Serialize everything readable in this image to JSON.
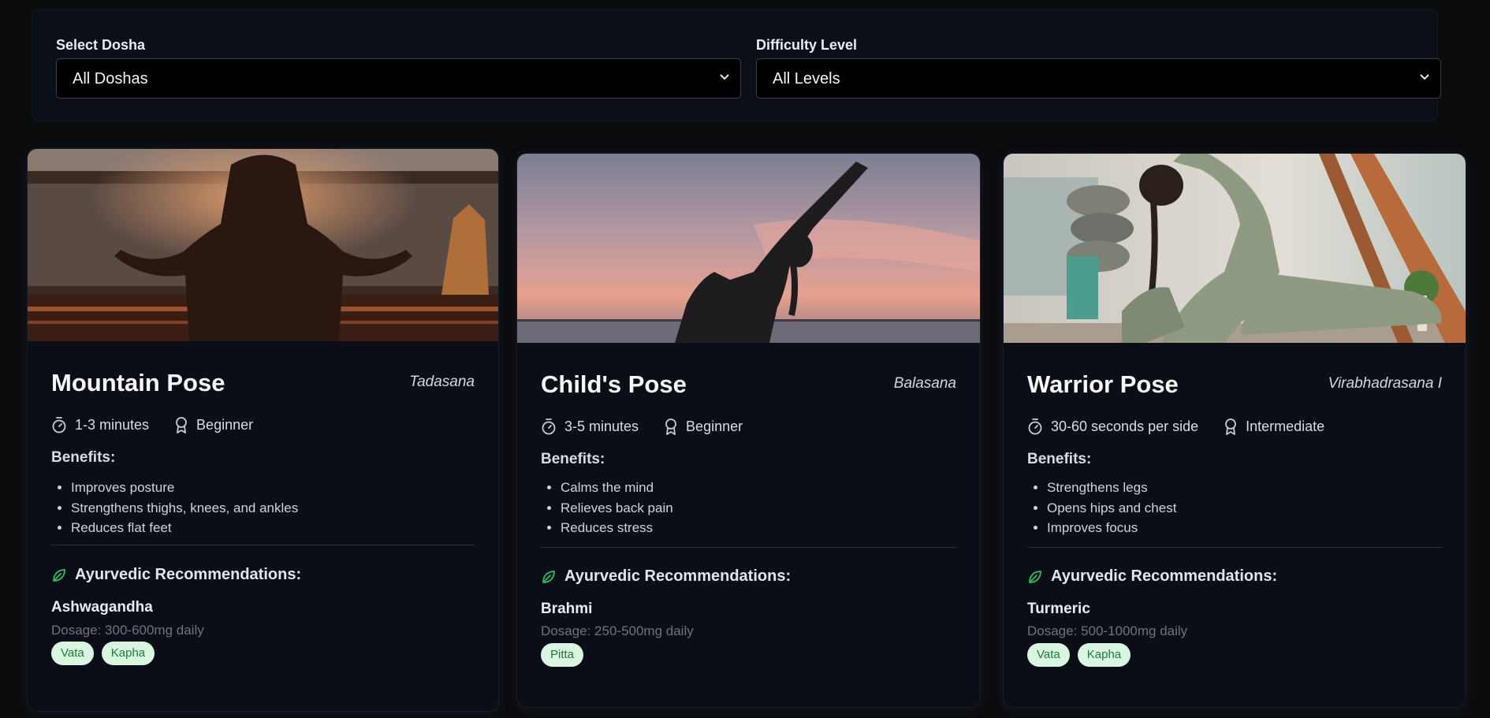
{
  "filters": {
    "dosha": {
      "label": "Select Dosha",
      "value": "All Doshas"
    },
    "difficulty": {
      "label": "Difficulty Level",
      "value": "All Levels"
    }
  },
  "cards": [
    {
      "name": "Mountain Pose",
      "sanskrit": "Tadasana",
      "duration": "1-3 minutes",
      "level": "Beginner",
      "benefits_title": "Benefits:",
      "benefits": [
        "Improves posture",
        "Strengthens thighs, knees, and ankles",
        "Reduces flat feet"
      ],
      "ayurvedic_title": "Ayurvedic Recommendations:",
      "herb": "Ashwagandha",
      "dosage": "Dosage: 300-600mg daily",
      "tags": [
        "Vata",
        "Kapha"
      ],
      "image_desc": "meditation-silhouette-photo"
    },
    {
      "name": "Child's Pose",
      "sanskrit": "Balasana",
      "duration": "3-5 minutes",
      "level": "Beginner",
      "benefits_title": "Benefits:",
      "benefits": [
        "Calms the mind",
        "Relieves back pain",
        "Reduces stress"
      ],
      "ayurvedic_title": "Ayurvedic Recommendations:",
      "herb": "Brahmi",
      "dosage": "Dosage: 250-500mg daily",
      "tags": [
        "Pitta"
      ],
      "image_desc": "sunset-yoga-silhouette-photo"
    },
    {
      "name": "Warrior Pose",
      "sanskrit": "Virabhadrasana I",
      "duration": "30-60 seconds per side",
      "level": "Intermediate",
      "benefits_title": "Benefits:",
      "benefits": [
        "Strengthens legs",
        "Opens hips and chest",
        "Improves focus"
      ],
      "ayurvedic_title": "Ayurvedic Recommendations:",
      "herb": "Turmeric",
      "dosage": "Dosage: 500-1000mg daily",
      "tags": [
        "Vata",
        "Kapha"
      ],
      "image_desc": "indoor-yoga-studio-photo"
    }
  ],
  "colors": {
    "accent_green": "#22c55e",
    "tag_bg": "#d9f7e0",
    "tag_text": "#1f7a3a"
  }
}
